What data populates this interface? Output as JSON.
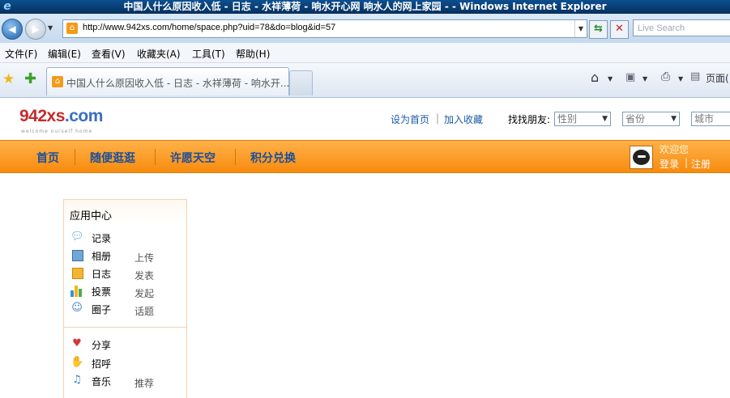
{
  "window": {
    "title": "中国人什么原因收入低 - 日志 - 水祥薄荷 - 响水开心网 响水人的网上家园 - - Windows Internet Explorer"
  },
  "address": {
    "url": "http://www.942xs.com/home/space.php?uid=78&do=blog&id=57",
    "search_placeholder": "Live Search"
  },
  "menu": {
    "items": [
      "文件(F)",
      "编辑(E)",
      "查看(V)",
      "收藏夹(A)",
      "工具(T)",
      "帮助(H)"
    ]
  },
  "tab": {
    "label": "中国人什么原因收入低 - 日志 - 水祥薄荷 - 响水开..."
  },
  "tools": {
    "page_label": "页面("
  },
  "site": {
    "logo_main": "942xs",
    "logo_tld": ".com",
    "logo_sub": "welcome ourself home",
    "set_home": "设为首页",
    "add_fav": "加入收藏",
    "find_friends": "找找朋友:",
    "gender": "性别",
    "province": "省份",
    "city": "城市"
  },
  "nav": {
    "items": [
      "首页",
      "随便逛逛",
      "许愿天空",
      "积分兑换"
    ]
  },
  "user": {
    "welcome": "欢迎您",
    "login": "登录",
    "register": "注册"
  },
  "app_center": {
    "title": "应用中心",
    "group1": [
      {
        "icon": "speech-bubble-icon",
        "label": "记录",
        "action": ""
      },
      {
        "icon": "photo-album-icon",
        "label": "相册",
        "action": "上传"
      },
      {
        "icon": "blog-icon",
        "label": "日志",
        "action": "发表"
      },
      {
        "icon": "poll-chart-icon",
        "label": "投票",
        "action": "发起"
      },
      {
        "icon": "group-icon",
        "label": "圈子",
        "action": "话题"
      }
    ],
    "group2": [
      {
        "icon": "share-hearts-icon",
        "label": "分享",
        "action": ""
      },
      {
        "icon": "handshake-icon",
        "label": "招呼",
        "action": ""
      },
      {
        "icon": "headphones-icon",
        "label": "音乐",
        "action": "推荐"
      }
    ]
  }
}
